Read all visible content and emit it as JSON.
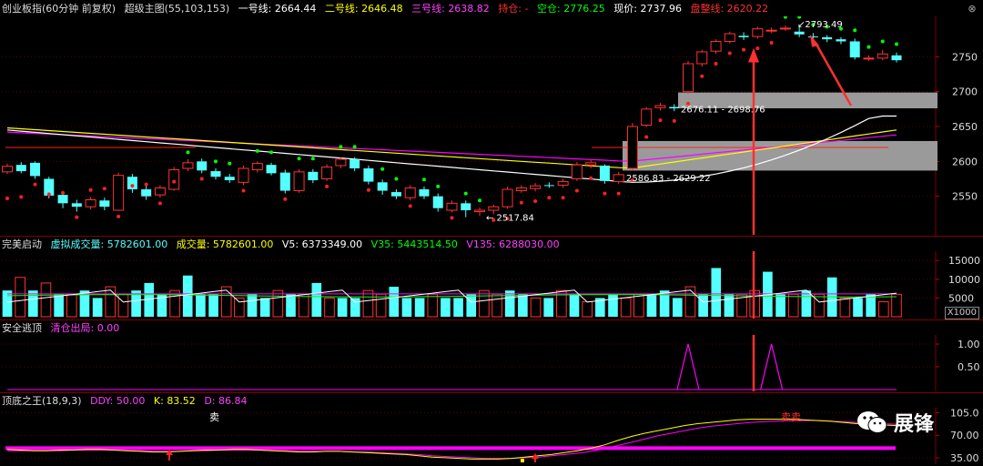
{
  "main_header": {
    "name": "创业板指(60分钟 前复权)",
    "indicator": "超级主图(55,103,153)",
    "line1_label": "一号线:",
    "line1_value": "2664.44",
    "line2_label": "二号线:",
    "line2_value": "2646.48",
    "line3_label": "三号线:",
    "line3_value": "2638.82",
    "hold_label": "持仓:",
    "hold_value": "-",
    "empty_label": "空仓:",
    "empty_value": "2776.25",
    "price_label": "现价:",
    "price_value": "2737.96",
    "consol_label": "盘整线:",
    "consol_value": "2620.22"
  },
  "main_axis": [
    "2750",
    "2700",
    "2650",
    "2600",
    "2550"
  ],
  "main_annotations": {
    "range_high": "2676.11 - 2698.76",
    "range_low": "2586.83 - 2629.22",
    "low_point": "2517.84",
    "high_point": "2793.49"
  },
  "vol_header": {
    "name": "完美启动",
    "virtual_label": "虚拟成交量:",
    "virtual_value": "5782601.00",
    "vol_label": "成交量:",
    "vol_value": "5782601.00",
    "v5_label": "V5:",
    "v5_value": "6373349.00",
    "v35_label": "V35:",
    "v35_value": "5443514.50",
    "v135_label": "V135:",
    "v135_value": "6288030.00"
  },
  "vol_axis": [
    "15000",
    "10000",
    "5000"
  ],
  "vol_unit": "X1000",
  "sig_header": {
    "name": "安全逃顶",
    "clear_label": "清仓出局:",
    "clear_value": "0.00"
  },
  "sig_axis": [
    "1.00",
    "0.50"
  ],
  "kdj_header": {
    "name": "顶底之王(18,9,3)",
    "ddy_label": "DDY:",
    "ddy_value": "50.00",
    "k_label": "K:",
    "k_value": "83.52",
    "d_label": "D:",
    "d_value": "86.84"
  },
  "kdj_axis": [
    "105.0",
    "70.00",
    "35.00"
  ],
  "kdj_marks": {
    "sell1": "卖",
    "sell2": "卖卖"
  },
  "watermark": {
    "text": "展锋"
  },
  "colors": {
    "up": "#ff3232",
    "down": "#54ffff",
    "line1": "#ffffff",
    "line2": "#ffff00",
    "line3": "#ff00ff",
    "signal": "#ff00ff",
    "dot_green": "#00ff00",
    "dot_red": "#ff2020"
  },
  "chart_data": {
    "type": "candlestick",
    "ylim": [
      2500,
      2800
    ],
    "candles": [
      {
        "o": 2585,
        "c": 2593,
        "h": 2597,
        "l": 2582
      },
      {
        "o": 2595,
        "c": 2586,
        "h": 2599,
        "l": 2583
      },
      {
        "o": 2598,
        "c": 2579,
        "h": 2600,
        "l": 2575
      },
      {
        "o": 2575,
        "c": 2551,
        "h": 2578,
        "l": 2547
      },
      {
        "o": 2552,
        "c": 2540,
        "h": 2556,
        "l": 2533
      },
      {
        "o": 2540,
        "c": 2535,
        "h": 2545,
        "l": 2528
      },
      {
        "o": 2535,
        "c": 2545,
        "h": 2549,
        "l": 2531
      },
      {
        "o": 2544,
        "c": 2535,
        "h": 2548,
        "l": 2530
      },
      {
        "o": 2530,
        "c": 2580,
        "h": 2584,
        "l": 2529
      },
      {
        "o": 2578,
        "c": 2560,
        "h": 2582,
        "l": 2555
      },
      {
        "o": 2560,
        "c": 2550,
        "h": 2565,
        "l": 2545
      },
      {
        "o": 2552,
        "c": 2562,
        "h": 2566,
        "l": 2548
      },
      {
        "o": 2560,
        "c": 2588,
        "h": 2592,
        "l": 2558
      },
      {
        "o": 2590,
        "c": 2598,
        "h": 2603,
        "l": 2586
      },
      {
        "o": 2600,
        "c": 2587,
        "h": 2604,
        "l": 2583
      },
      {
        "o": 2586,
        "c": 2578,
        "h": 2590,
        "l": 2574
      },
      {
        "o": 2578,
        "c": 2573,
        "h": 2582,
        "l": 2569
      },
      {
        "o": 2570,
        "c": 2590,
        "h": 2594,
        "l": 2566
      },
      {
        "o": 2588,
        "c": 2597,
        "h": 2600,
        "l": 2584
      },
      {
        "o": 2595,
        "c": 2583,
        "h": 2598,
        "l": 2580
      },
      {
        "o": 2584,
        "c": 2558,
        "h": 2588,
        "l": 2554
      },
      {
        "o": 2558,
        "c": 2585,
        "h": 2589,
        "l": 2555
      },
      {
        "o": 2585,
        "c": 2573,
        "h": 2589,
        "l": 2569
      },
      {
        "o": 2575,
        "c": 2592,
        "h": 2596,
        "l": 2572
      },
      {
        "o": 2594,
        "c": 2603,
        "h": 2606,
        "l": 2590
      },
      {
        "o": 2603,
        "c": 2590,
        "h": 2606,
        "l": 2586
      },
      {
        "o": 2590,
        "c": 2571,
        "h": 2594,
        "l": 2567
      },
      {
        "o": 2570,
        "c": 2558,
        "h": 2574,
        "l": 2552
      },
      {
        "o": 2556,
        "c": 2550,
        "h": 2560,
        "l": 2546
      },
      {
        "o": 2548,
        "c": 2562,
        "h": 2566,
        "l": 2544
      },
      {
        "o": 2560,
        "c": 2550,
        "h": 2564,
        "l": 2546
      },
      {
        "o": 2550,
        "c": 2533,
        "h": 2554,
        "l": 2528
      },
      {
        "o": 2530,
        "c": 2540,
        "h": 2544,
        "l": 2527
      },
      {
        "o": 2540,
        "c": 2530,
        "h": 2544,
        "l": 2520
      },
      {
        "o": 2528,
        "c": 2530,
        "h": 2534,
        "l": 2522
      },
      {
        "o": 2530,
        "c": 2535,
        "h": 2538,
        "l": 2524
      },
      {
        "o": 2535,
        "c": 2560,
        "h": 2564,
        "l": 2532
      },
      {
        "o": 2558,
        "c": 2562,
        "h": 2566,
        "l": 2555
      },
      {
        "o": 2561,
        "c": 2565,
        "h": 2569,
        "l": 2557
      },
      {
        "o": 2566,
        "c": 2565,
        "h": 2570,
        "l": 2562
      },
      {
        "o": 2566,
        "c": 2571,
        "h": 2575,
        "l": 2562
      },
      {
        "o": 2575,
        "c": 2595,
        "h": 2599,
        "l": 2572
      },
      {
        "o": 2595,
        "c": 2598,
        "h": 2602,
        "l": 2590
      },
      {
        "o": 2594,
        "c": 2572,
        "h": 2596,
        "l": 2568
      },
      {
        "o": 2571,
        "c": 2581,
        "h": 2585,
        "l": 2568
      },
      {
        "o": 2590,
        "c": 2650,
        "h": 2655,
        "l": 2587
      },
      {
        "o": 2652,
        "c": 2675,
        "h": 2678,
        "l": 2649
      },
      {
        "o": 2677,
        "c": 2680,
        "h": 2684,
        "l": 2673
      },
      {
        "o": 2678,
        "c": 2676,
        "h": 2682,
        "l": 2672
      },
      {
        "o": 2700,
        "c": 2740,
        "h": 2744,
        "l": 2697
      },
      {
        "o": 2740,
        "c": 2757,
        "h": 2760,
        "l": 2736
      },
      {
        "o": 2758,
        "c": 2772,
        "h": 2775,
        "l": 2754
      },
      {
        "o": 2772,
        "c": 2783,
        "h": 2786,
        "l": 2769
      },
      {
        "o": 2780,
        "c": 2778,
        "h": 2785,
        "l": 2774
      },
      {
        "o": 2779,
        "c": 2790,
        "h": 2793,
        "l": 2776
      },
      {
        "o": 2788,
        "c": 2788,
        "h": 2792,
        "l": 2784
      },
      {
        "o": 2790,
        "c": 2791,
        "h": 2795,
        "l": 2787
      },
      {
        "o": 2786,
        "c": 2782,
        "h": 2795,
        "l": 2778
      },
      {
        "o": 2779,
        "c": 2778,
        "h": 2784,
        "l": 2774
      },
      {
        "o": 2778,
        "c": 2775,
        "h": 2781,
        "l": 2771
      },
      {
        "o": 2775,
        "c": 2772,
        "h": 2778,
        "l": 2768
      },
      {
        "o": 2772,
        "c": 2749,
        "h": 2776,
        "l": 2746
      },
      {
        "o": 2748,
        "c": 2748,
        "h": 2752,
        "l": 2744
      },
      {
        "o": 2748,
        "c": 2754,
        "h": 2760,
        "l": 2745
      },
      {
        "o": 2752,
        "c": 2745,
        "h": 2756,
        "l": 2742
      }
    ],
    "volume": [
      7,
      10.5,
      7,
      9,
      6,
      6,
      7,
      5,
      8,
      6,
      7,
      9,
      6,
      7,
      11,
      6,
      6,
      8,
      5,
      6,
      5,
      7,
      6,
      6,
      9,
      5,
      5,
      5,
      7,
      6,
      8,
      5,
      5,
      6,
      5,
      5,
      6,
      7,
      6,
      7,
      6,
      5,
      5,
      7,
      6,
      4,
      5,
      6,
      5,
      6,
      6,
      7,
      5,
      8,
      6,
      13,
      6,
      6,
      7,
      12,
      6,
      6,
      7,
      6,
      10.5,
      5,
      5,
      6,
      4,
      6
    ],
    "vol_ylim": [
      0,
      17000
    ],
    "signal_peaks": [
      49,
      55
    ],
    "kdj_k": [
      48,
      47,
      46,
      46,
      47,
      47,
      48,
      48,
      47,
      46,
      45,
      44,
      44,
      45,
      46,
      47,
      47,
      48,
      48,
      47,
      46,
      45,
      44,
      44,
      45,
      45,
      44,
      43,
      42,
      41,
      40,
      38,
      36,
      35,
      34,
      33,
      33,
      33,
      34,
      36,
      38,
      40,
      43,
      46,
      50,
      55,
      62,
      68,
      73,
      77,
      81,
      85,
      88,
      90,
      92,
      94,
      95,
      95,
      95,
      95,
      94,
      93,
      92,
      90,
      88,
      87,
      86,
      85
    ],
    "kdj_d": [
      46,
      46,
      46,
      46,
      46,
      47,
      47,
      47,
      47,
      46,
      46,
      45,
      45,
      45,
      46,
      46,
      47,
      47,
      47,
      47,
      46,
      46,
      45,
      45,
      45,
      45,
      44,
      44,
      43,
      42,
      41,
      40,
      38,
      37,
      36,
      35,
      34,
      34,
      34,
      35,
      36,
      38,
      40,
      42,
      45,
      49,
      54,
      59,
      64,
      69,
      73,
      77,
      81,
      84,
      86,
      88,
      90,
      91,
      92,
      93,
      93,
      93,
      92,
      91,
      90,
      89,
      88,
      87
    ],
    "kdj_ylim": [
      25,
      110
    ]
  }
}
